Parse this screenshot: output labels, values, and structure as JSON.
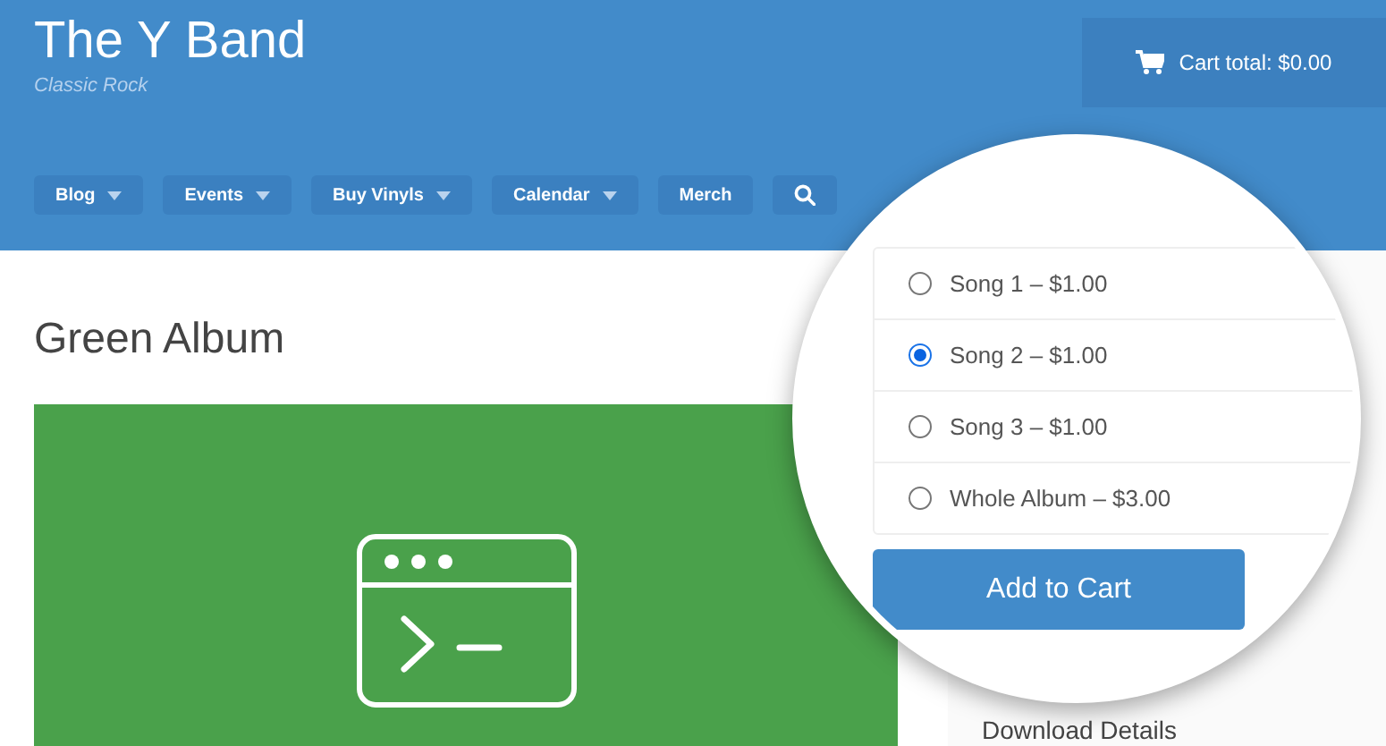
{
  "site": {
    "title": "The Y Band",
    "tagline": "Classic Rock"
  },
  "cart": {
    "label": "Cart total: $0.00"
  },
  "nav": [
    {
      "kind": "menu",
      "label": "Blog",
      "dropdown": true
    },
    {
      "kind": "menu",
      "label": "Events",
      "dropdown": true
    },
    {
      "kind": "menu",
      "label": "Buy Vinyls",
      "dropdown": true
    },
    {
      "kind": "menu",
      "label": "Calendar",
      "dropdown": true
    },
    {
      "kind": "menu",
      "label": "Merch",
      "dropdown": false
    },
    {
      "kind": "search"
    }
  ],
  "page": {
    "title": "Green Album"
  },
  "product_options": [
    {
      "label": "Song 1 – $1.00",
      "selected": false
    },
    {
      "label": "Song 2 – $1.00",
      "selected": true
    },
    {
      "label": "Song 3 – $1.00",
      "selected": false
    },
    {
      "label": "Whole Album – $3.00",
      "selected": false
    }
  ],
  "add_to_cart": "Add to Cart",
  "sidebar": {
    "heading": "Download Details"
  }
}
